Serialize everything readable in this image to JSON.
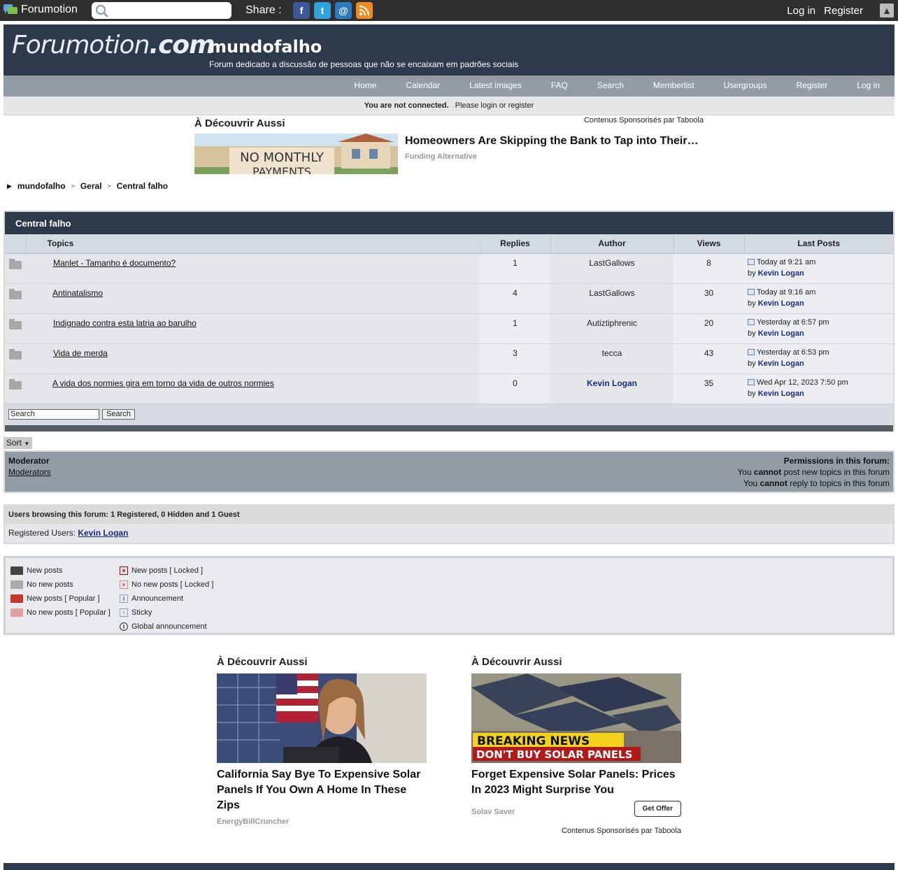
{
  "topbar": {
    "brand": "Forumotion",
    "search_placeholder": "",
    "share_label": "Share :",
    "share_icons": [
      "facebook-icon",
      "twitter-icon",
      "email-icon",
      "rss-icon"
    ],
    "login": "Log in",
    "register": "Register"
  },
  "header": {
    "logo_main": "Forumotion",
    "logo_dot": ".com",
    "title": "mundofalho",
    "description": "Forum dedicado a discussão de pessoas que não se encaixam em padrões sociais"
  },
  "nav": {
    "items": [
      "Home",
      "Calendar",
      "Latest images",
      "FAQ",
      "Search",
      "Memberlist",
      "Usergroups",
      "Register",
      "Log in"
    ]
  },
  "notice": {
    "bold": "You are not connected.",
    "please": "Please",
    "login": "login",
    "or": "or",
    "register": "register"
  },
  "sponsor_top": {
    "heading": "À Découvrir Aussi",
    "byline": "Contenus Sponsorisés par Taboola",
    "image_text_1": "NO MONTHLY",
    "image_text_2": "PAYMENTS",
    "headline": "Homeowners Are Skipping the Bank to Tap into Their…",
    "source": "Funding Alternative"
  },
  "breadcrumb": [
    "mundofalho",
    "Geral",
    "Central falho"
  ],
  "forum": {
    "category": "Central falho",
    "columns": [
      "Topics",
      "Replies",
      "Author",
      "Views",
      "Last Posts"
    ],
    "rows": [
      {
        "title": "Manlet - Tamanho é documento?",
        "replies": "1",
        "author": "LastGallows",
        "views": "8",
        "last_time": "Today at 9:21 am",
        "by": "by",
        "last_user": "Kevin Logan",
        "author_highlight": false
      },
      {
        "title": "Antinatalismo ",
        "replies": "4",
        "author": "LastGallows",
        "views": "30",
        "last_time": "Today at 9:16 am",
        "by": "by",
        "last_user": "Kevin Logan",
        "author_highlight": false
      },
      {
        "title": "Indignado contra esta latria ao barulho",
        "replies": "1",
        "author": "Autiztiphrenic",
        "views": "20",
        "last_time": "Yesterday at 6:57 pm",
        "by": "by",
        "last_user": "Kevin Logan",
        "author_highlight": false
      },
      {
        "title": "Vida de merda",
        "replies": "3",
        "author": "tecca",
        "views": "43",
        "last_time": "Yesterday at 6:53 pm",
        "by": "by",
        "last_user": "Kevin Logan",
        "author_highlight": false
      },
      {
        "title": "A vida dos normies gira em torno da vida de outros normies",
        "replies": "0",
        "author": "Kevin Logan",
        "views": "35",
        "last_time": "Wed Apr 12, 2023 7:50 pm",
        "by": "by",
        "last_user": "Kevin Logan",
        "author_highlight": true
      }
    ],
    "search_value": "Search",
    "search_button": "Search"
  },
  "sort_label": "Sort",
  "permissions": {
    "moderator_label": "Moderator",
    "moderators_link": "Moderators",
    "title": "Permissions in this forum:",
    "line1_pre": "You",
    "line1_bold": "cannot",
    "line1_post": "post new topics in this forum",
    "line2_pre": "You",
    "line2_bold": "cannot",
    "line2_post": "reply to topics in this forum"
  },
  "browsing": {
    "header": "Users browsing this forum: 1 Registered, 0 Hidden and 1 Guest",
    "label": "Registered Users:",
    "user": "Kevin Logan"
  },
  "legend": {
    "left": [
      "New posts",
      "No new posts",
      "New posts [ Popular ]",
      "No new posts [ Popular ]"
    ],
    "right": [
      "New posts [ Locked ]",
      "No new posts [ Locked ]",
      "Announcement",
      "Sticky",
      "Global announcement"
    ]
  },
  "sponsor_bottom": [
    {
      "heading": "À Découvrir Aussi",
      "headline": "California Say Bye To Expensive Solar Panels If You Own A Home In These Zips",
      "source": "EnergyBillCruncher"
    },
    {
      "heading": "À Découvrir Aussi",
      "headline": "Forget Expensive Solar Panels: Prices In 2023 Might Surprise You",
      "source": "Solav Saver",
      "cta": "Get Offer",
      "byline": "Contenus Sponsorisés par Taboola",
      "banner_1": "BREAKING NEWS",
      "banner_2": "DON'T BUY SOLAR PANELS"
    }
  ],
  "colors": {
    "header_bg": "#2c3a4c",
    "nav_bg": "#939ca5",
    "link_user": "#1a2d7a"
  }
}
